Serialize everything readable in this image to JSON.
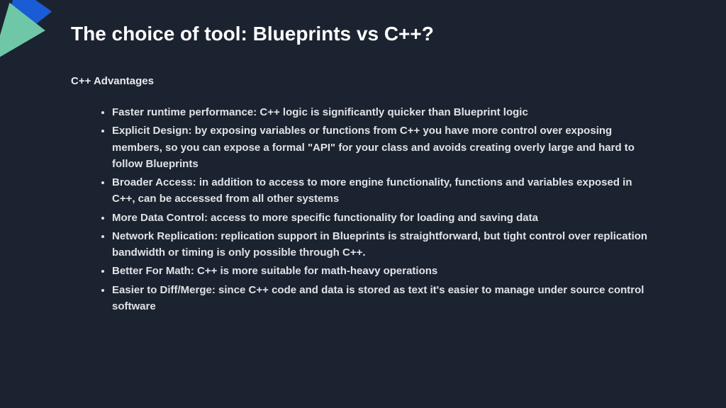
{
  "title": "The choice of tool: Blueprints vs C++?",
  "subtitle": "C++ Advantages",
  "items": [
    {
      "lead": "Faster runtime performance: ",
      "body": "C++ logic is significantly quicker than Blueprint logic"
    },
    {
      "lead": "Explicit Design: ",
      "body": "by exposing variables or functions from C++ you have more control over exposing members, so you can expose a formal \"API\" for your class and avoids creating overly large and hard to follow Blueprints"
    },
    {
      "lead": "Broader Access: ",
      "body": "in addition to access to more engine functionality, functions and variables exposed in C++, can be accessed from all other systems"
    },
    {
      "lead": "More Data Control: ",
      "body": "access to more specific functionality for loading and saving data"
    },
    {
      "lead": "Network Replication: ",
      "body": "replication support in Blueprints is straightforward, but tight control over replication bandwidth or timing is only possible through C++."
    },
    {
      "lead": "Better For Math: ",
      "body": "C++ is more suitable for math-heavy operations"
    },
    {
      "lead": "Easier to Diff/Merge: ",
      "body": "since C++ code and data is stored as text it's easier to manage under source control software"
    }
  ]
}
